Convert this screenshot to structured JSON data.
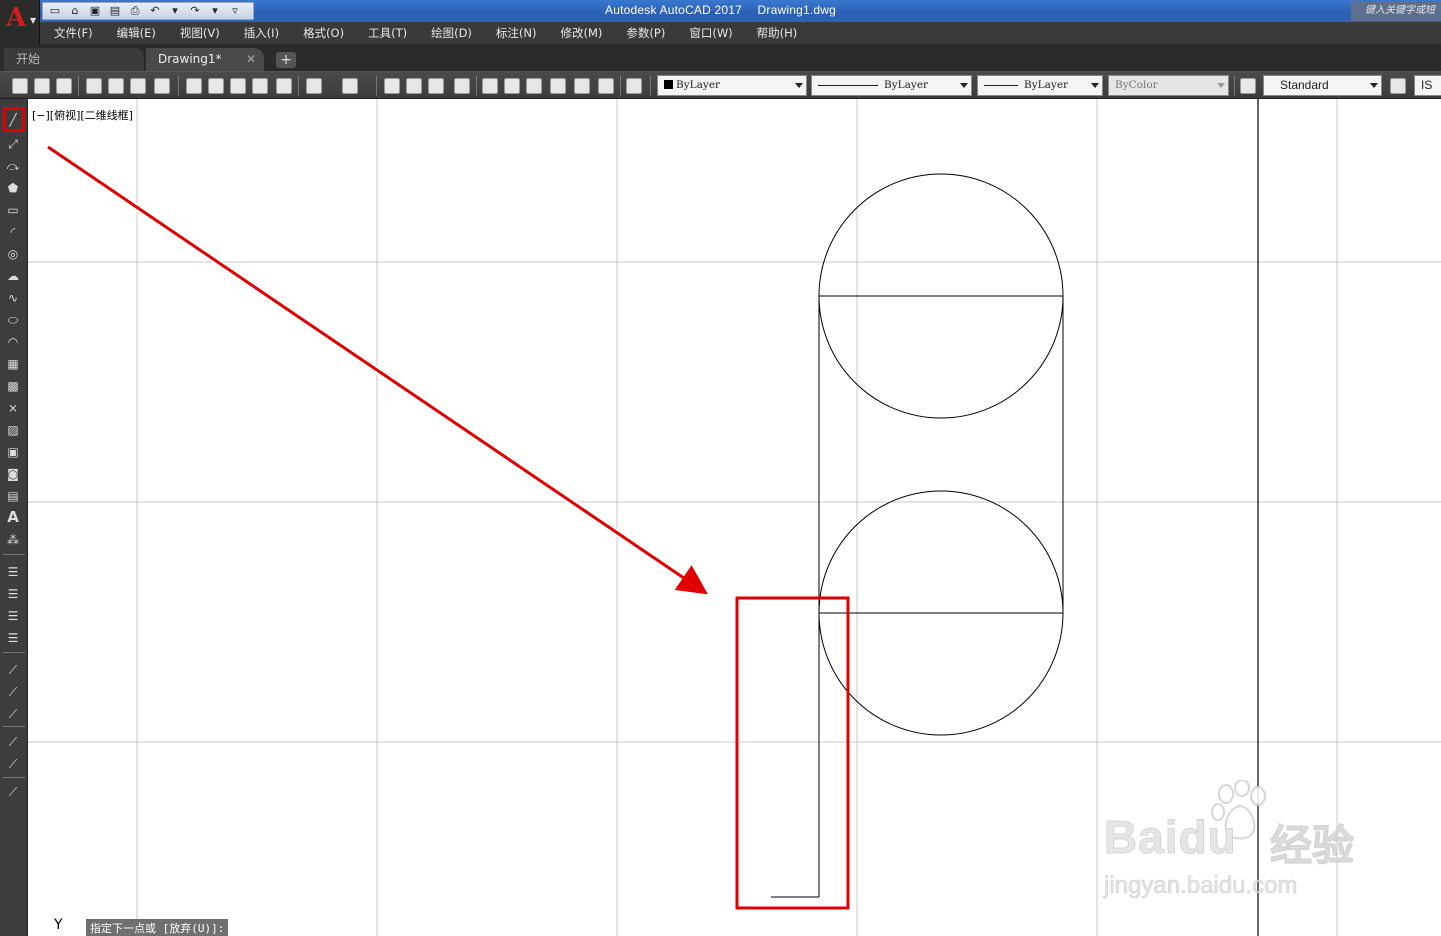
{
  "app": {
    "product": "Autodesk AutoCAD 2017",
    "file": "Drawing1.dwg",
    "search_placeholder": "键入关键字或短语"
  },
  "menu": [
    "文件(F)",
    "编辑(E)",
    "视图(V)",
    "插入(I)",
    "格式(O)",
    "工具(T)",
    "绘图(D)",
    "标注(N)",
    "修改(M)",
    "参数(P)",
    "窗口(W)",
    "帮助(H)"
  ],
  "tabs": {
    "start": "开始",
    "drawing": "Drawing1*",
    "close_glyph": "✕",
    "add_glyph": "+"
  },
  "properties": {
    "layer_color": "ByLayer",
    "linetype": "ByLayer",
    "lineweight": "ByLayer",
    "plot_color": "ByColor",
    "text_style": "Standard",
    "dim_style_partial": "IS"
  },
  "viewport": {
    "label": "[−][俯视][二维线框]",
    "ucs_axis": "Y"
  },
  "command": {
    "prompt": "指定下一点或 [放弃(U)]:"
  },
  "watermark": {
    "brand": "Baidu",
    "brand_cn": "经验",
    "url": "jingyan.baidu.com"
  },
  "colors": {
    "annotation_red": "#e00000",
    "grid": "#c8c8c8",
    "geometry": "#000000"
  },
  "icons": {
    "left_palette": [
      "line-icon",
      "construction-line-icon",
      "polyline-icon",
      "polygon-icon",
      "rectangle-icon",
      "arc-icon",
      "circle-icon",
      "revision-cloud-icon",
      "spline-icon",
      "ellipse-icon",
      "ellipse-arc-icon",
      "insert-block-icon",
      "make-block-icon",
      "point-icon",
      "hatch-icon",
      "gradient-icon",
      "region-icon",
      "table-icon",
      "multiline-text-icon",
      "add-selected-icon"
    ]
  }
}
